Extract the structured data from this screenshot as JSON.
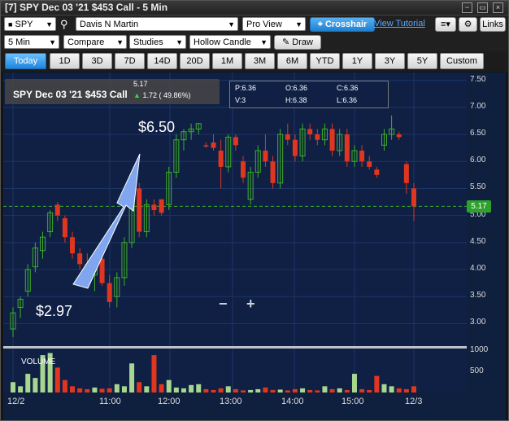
{
  "window": {
    "title": "[7] SPY Dec 03 '21 $453 Call - 5 Min"
  },
  "toolbar1": {
    "symbol": "SPY",
    "account": "Davis N Martin",
    "view": "Pro View",
    "crosshair": "Crosshair",
    "tutorial": "View Tutorial",
    "links": "Links"
  },
  "toolbar2": {
    "interval": "5 Min",
    "compare": "Compare",
    "studies": "Studies",
    "candle": "Hollow Candle",
    "draw": "Draw"
  },
  "tabs": [
    "Today",
    "1D",
    "3D",
    "7D",
    "14D",
    "20D",
    "1M",
    "3M",
    "6M",
    "YTD",
    "1Y",
    "3Y",
    "5Y",
    "Custom"
  ],
  "info": {
    "name": "SPY Dec 03 '21 $453 Call",
    "price": "5.17",
    "change": "1.72 ( 49.86%)"
  },
  "ohlc": {
    "P": "6.36",
    "O": "6.36",
    "C": "6.36",
    "V": "3",
    "H": "6.38",
    "L": "6.36"
  },
  "annotations": {
    "high": "$6.50",
    "low": "$2.97"
  },
  "zoom": {
    "minus": "−",
    "plus": "+"
  },
  "volume_label": "VOLUME",
  "current_price_label": "5.17",
  "colors": {
    "up": "#3fae2a",
    "down": "#e0361f",
    "bg": "#0f2044",
    "arrow": "#7fa6ee"
  },
  "chart_data": {
    "type": "candlestick",
    "title": "SPY Dec 03 '21 $453 Call - 5 Min",
    "x_ticks": [
      "12/2",
      "11:00",
      "12:00",
      "13:00",
      "14:00",
      "15:00",
      "12/3"
    ],
    "y_ticks": [
      7.5,
      7.0,
      6.5,
      6.0,
      5.5,
      5.0,
      4.5,
      4.0,
      3.5,
      3.0
    ],
    "volume_ticks": [
      1000,
      500
    ],
    "ylim": [
      2.6,
      7.6
    ],
    "reference_line": 5.17,
    "candles": [
      {
        "o": 2.9,
        "h": 3.3,
        "l": 2.75,
        "c": 3.2
      },
      {
        "o": 3.3,
        "h": 3.5,
        "l": 3.1,
        "c": 3.45
      },
      {
        "o": 3.6,
        "h": 4.1,
        "l": 3.5,
        "c": 4.0
      },
      {
        "o": 4.05,
        "h": 4.5,
        "l": 3.95,
        "c": 4.4
      },
      {
        "o": 4.35,
        "h": 4.7,
        "l": 4.2,
        "c": 4.6
      },
      {
        "o": 4.7,
        "h": 5.1,
        "l": 4.6,
        "c": 5.05
      },
      {
        "o": 5.2,
        "h": 5.25,
        "l": 4.9,
        "c": 5.0
      },
      {
        "o": 4.95,
        "h": 5.0,
        "l": 4.5,
        "c": 4.6
      },
      {
        "o": 4.6,
        "h": 4.7,
        "l": 4.2,
        "c": 4.3
      },
      {
        "o": 4.3,
        "h": 4.4,
        "l": 4.0,
        "c": 4.1
      },
      {
        "o": 4.1,
        "h": 4.3,
        "l": 3.8,
        "c": 3.9
      },
      {
        "o": 3.9,
        "h": 4.3,
        "l": 3.6,
        "c": 4.2
      },
      {
        "o": 4.2,
        "h": 4.4,
        "l": 3.7,
        "c": 3.75
      },
      {
        "o": 3.75,
        "h": 3.9,
        "l": 3.3,
        "c": 3.4
      },
      {
        "o": 3.5,
        "h": 3.95,
        "l": 3.3,
        "c": 3.85
      },
      {
        "o": 3.85,
        "h": 4.6,
        "l": 3.7,
        "c": 4.5
      },
      {
        "o": 4.5,
        "h": 5.4,
        "l": 4.4,
        "c": 5.3
      },
      {
        "o": 5.5,
        "h": 5.6,
        "l": 4.6,
        "c": 4.7
      },
      {
        "o": 4.7,
        "h": 5.3,
        "l": 4.6,
        "c": 5.2
      },
      {
        "o": 5.2,
        "h": 5.3,
        "l": 5.0,
        "c": 5.1
      },
      {
        "o": 5.3,
        "h": 5.3,
        "l": 5.0,
        "c": 5.05
      },
      {
        "o": 5.2,
        "h": 5.9,
        "l": 5.1,
        "c": 5.8
      },
      {
        "o": 5.8,
        "h": 6.5,
        "l": 5.7,
        "c": 6.4
      },
      {
        "o": 6.4,
        "h": 6.6,
        "l": 6.2,
        "c": 6.55
      },
      {
        "o": 6.55,
        "h": 6.7,
        "l": 6.4,
        "c": 6.6
      },
      {
        "o": 6.6,
        "h": 6.7,
        "l": 6.5,
        "c": 6.7
      },
      {
        "o": 6.3,
        "h": 6.35,
        "l": 6.25,
        "c": 6.28
      },
      {
        "o": 6.35,
        "h": 6.5,
        "l": 6.2,
        "c": 6.25
      },
      {
        "o": 6.2,
        "h": 6.4,
        "l": 5.5,
        "c": 5.9
      },
      {
        "o": 5.9,
        "h": 6.5,
        "l": 5.8,
        "c": 6.45
      },
      {
        "o": 6.45,
        "h": 6.5,
        "l": 6.2,
        "c": 6.3
      },
      {
        "o": 6.0,
        "h": 6.1,
        "l": 5.6,
        "c": 5.7
      },
      {
        "o": 5.3,
        "h": 5.9,
        "l": 5.2,
        "c": 5.8
      },
      {
        "o": 5.8,
        "h": 6.3,
        "l": 5.7,
        "c": 6.2
      },
      {
        "o": 6.2,
        "h": 6.5,
        "l": 5.9,
        "c": 6.0
      },
      {
        "o": 6.0,
        "h": 6.1,
        "l": 5.5,
        "c": 5.6
      },
      {
        "o": 5.6,
        "h": 6.6,
        "l": 5.5,
        "c": 6.5
      },
      {
        "o": 6.5,
        "h": 6.7,
        "l": 6.3,
        "c": 6.4
      },
      {
        "o": 6.4,
        "h": 6.5,
        "l": 6.0,
        "c": 6.1
      },
      {
        "o": 6.1,
        "h": 6.7,
        "l": 6.0,
        "c": 6.6
      },
      {
        "o": 6.6,
        "h": 6.7,
        "l": 6.4,
        "c": 6.5
      },
      {
        "o": 6.5,
        "h": 6.6,
        "l": 6.3,
        "c": 6.4
      },
      {
        "o": 6.4,
        "h": 6.7,
        "l": 6.3,
        "c": 6.6
      },
      {
        "o": 6.6,
        "h": 6.7,
        "l": 6.1,
        "c": 6.2
      },
      {
        "o": 6.2,
        "h": 6.6,
        "l": 6.1,
        "c": 6.5
      },
      {
        "o": 6.5,
        "h": 6.6,
        "l": 5.9,
        "c": 6.0
      },
      {
        "o": 6.0,
        "h": 6.3,
        "l": 5.9,
        "c": 6.2
      },
      {
        "o": 6.2,
        "h": 6.3,
        "l": 5.9,
        "c": 6.0
      },
      {
        "o": 6.0,
        "h": 6.1,
        "l": 5.85,
        "c": 5.9
      },
      {
        "o": 5.85,
        "h": 5.9,
        "l": 5.7,
        "c": 5.75
      },
      {
        "o": 6.3,
        "h": 6.6,
        "l": 6.2,
        "c": 6.5
      },
      {
        "o": 6.5,
        "h": 6.85,
        "l": 6.4,
        "c": 6.6
      },
      {
        "o": 6.5,
        "h": 6.55,
        "l": 6.4,
        "c": 6.45
      },
      {
        "o": 5.95,
        "h": 6.0,
        "l": 5.4,
        "c": 5.6
      },
      {
        "o": 5.5,
        "h": 5.6,
        "l": 4.9,
        "c": 5.17
      }
    ],
    "volumes": [
      250,
      150,
      450,
      350,
      900,
      950,
      600,
      300,
      150,
      100,
      80,
      120,
      90,
      100,
      200,
      150,
      700,
      250,
      150,
      900,
      200,
      300,
      120,
      100,
      180,
      200,
      80,
      60,
      100,
      150,
      80,
      50,
      60,
      80,
      120,
      60,
      70,
      50,
      80,
      100,
      60,
      50,
      150,
      80,
      100,
      60,
      450,
      80,
      60,
      400,
      200,
      150,
      100,
      80,
      150
    ]
  }
}
